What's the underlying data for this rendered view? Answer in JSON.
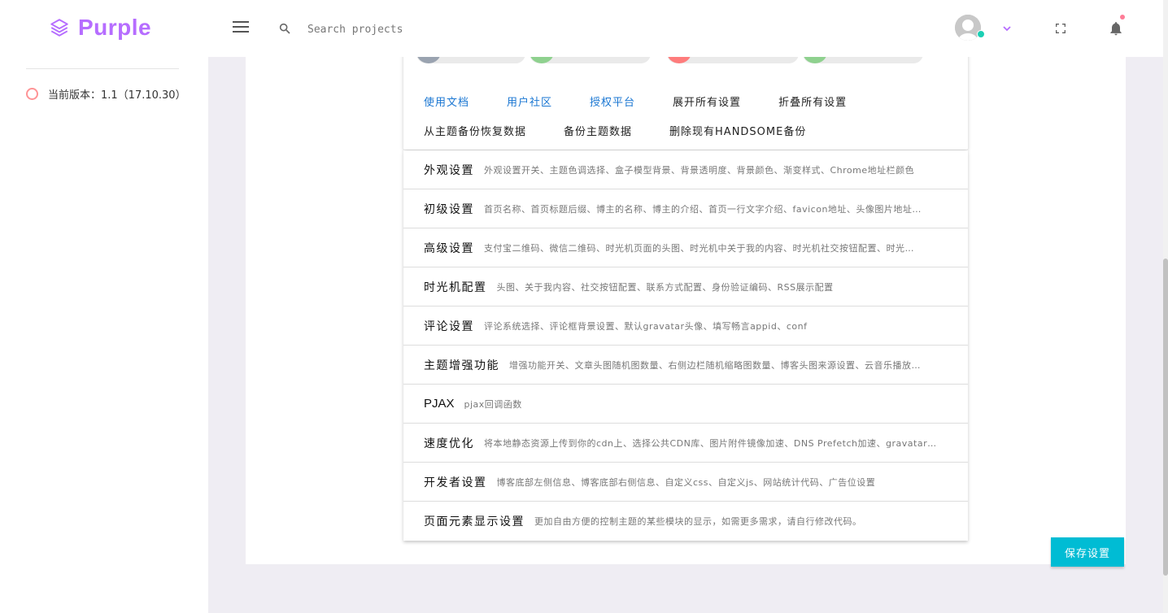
{
  "brand": {
    "name": "Purple",
    "color": "#b66dff"
  },
  "search": {
    "placeholder": "Search projects"
  },
  "sidebar": {
    "version_label": "当前版本：1.1（17.10.30）"
  },
  "top_links": {
    "row1": [
      {
        "label": "使用文档",
        "style": "blue"
      },
      {
        "label": "用户社区",
        "style": "blue"
      },
      {
        "label": "授权平台",
        "style": "blue"
      },
      {
        "label": "展开所有设置",
        "style": "dark"
      },
      {
        "label": "折叠所有设置",
        "style": "dark"
      }
    ],
    "row2": [
      {
        "label": "从主题备份恢复数据",
        "style": "dark"
      },
      {
        "label": "备份主题数据",
        "style": "dark"
      },
      {
        "label": "删除现有HANDSOME备份",
        "style": "dark"
      }
    ]
  },
  "settings": [
    {
      "title": "外观设置",
      "desc": "外观设置开关、主题色调选择、盒子模型背景、背景透明度、背景颜色、渐变样式、Chrome地址栏颜色"
    },
    {
      "title": "初级设置",
      "desc": "首页名称、首页标题后缀、博主的名称、博主的介绍、首页一行文字介绍、favicon地址、头像图片地址…"
    },
    {
      "title": "高级设置",
      "desc": "支付宝二维码、微信二维码、时光机页面的头图、时光机中关于我的内容、时光机社交按钮配置、时光…"
    },
    {
      "title": "时光机配置",
      "desc": "头图、关于我内容、社交按钮配置、联系方式配置、身份验证编码、RSS展示配置"
    },
    {
      "title": "评论设置",
      "desc": "评论系统选择、评论框背景设置、默认gravatar头像、填写畅言appid、conf"
    },
    {
      "title": "主题增强功能",
      "desc": "增强功能开关、文章头图随机图数量、右侧边栏随机缩略图数量、博客头图来源设置、云音乐播放…"
    },
    {
      "title": "PJAX",
      "desc": "pjax回调函数",
      "latin": true
    },
    {
      "title": "速度优化",
      "desc": "将本地静态资源上传到你的cdn上、选择公共CDN库、图片附件镜像加速、DNS Prefetch加速、gravatar…"
    },
    {
      "title": "开发者设置",
      "desc": "博客底部左侧信息、博客底部右侧信息、自定义css、自定义js、网站统计代码、广告位设置"
    },
    {
      "title": "页面元素显示设置",
      "desc": "更加自由方便的控制主题的某些模块的显示，如需更多需求，请自行修改代码。"
    }
  ],
  "save_button": {
    "label": "保存设置",
    "color": "#00bcd4"
  },
  "pills": [
    {
      "color": "#9aa3b0"
    },
    {
      "color": "#8fd18f"
    },
    {
      "color": "#fe7c7c"
    },
    {
      "color": "#8fd18f"
    }
  ]
}
